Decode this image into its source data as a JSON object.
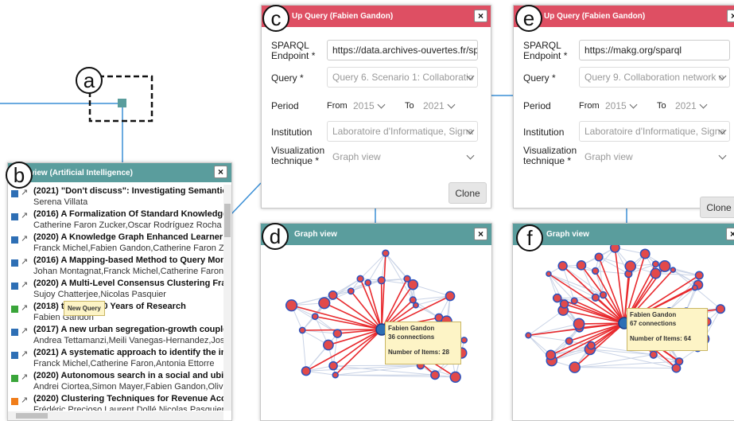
{
  "badges": {
    "a": "a",
    "b": "b",
    "c": "c",
    "d": "d",
    "e": "e",
    "f": "f"
  },
  "colors": {
    "teal": "#5a9d9d",
    "red_header": "#de4f63",
    "edge": "#e8292d",
    "node_fill": "#e24a4a",
    "node_stroke": "#2a52be",
    "blue": "#2e6fb5",
    "green": "#3aa53a",
    "orange": "#f07d1a",
    "link_line": "#3a8fd6"
  },
  "list_panel": {
    "title": "view (Artificial Intelligence)",
    "close": "×",
    "tooltip": "New Query",
    "items": [
      {
        "title": "(2021) \"Don't discuss\": Investigating Semantic and",
        "authors": "Serena Villata",
        "color": "blue"
      },
      {
        "title": "(2016) A Formalization Of Standard Knowledge Ar",
        "authors": "Catherine Faron Zucker,Oscar Rodríguez Rocha",
        "color": "blue"
      },
      {
        "title": "(2020) A Knowledge Graph Enhanced Learner Mo",
        "authors": "Franck Michel,Fabien Gandon,Catherine Faron Zucke",
        "color": "blue"
      },
      {
        "title": "(2016) A Mapping-based Method to Query Mongo",
        "authors": "Johan Montagnat,Franck Michel,Catherine Faron Zu",
        "color": "blue"
      },
      {
        "title": "(2020) A Multi-Level Consensus Clustering Frame",
        "authors": "Sujoy Chatterjee,Nicolas Pasquier",
        "color": "blue"
      },
      {
        "title": "(2018)          the First 20 Years of Research",
        "authors": "Fabien Gandon",
        "color": "green"
      },
      {
        "title": "(2017) A new urban segregation-growth coupled",
        "authors": "Andrea Tettamanzi,Meili Vanegas-Hernandez,José T",
        "color": "blue"
      },
      {
        "title": "(2021) A systematic approach to identify the inforn",
        "authors": "Franck Michel,Catherine Faron,Antonia Ettorre",
        "color": "blue"
      },
      {
        "title": "(2020) Autonomous search in a social and ubiqui",
        "authors": "Andrei Ciortea,Simon Mayer,Fabien Gandon,Olivier",
        "color": "green"
      },
      {
        "title": "(2020) Clustering Techniques for Revenue Accou",
        "authors": "Frédéric Precioso,Laurent Dollé,Nicolas Pasquier,Tia",
        "color": "orange"
      }
    ]
  },
  "query_c": {
    "title": "Up Query (Fabien Gandon)",
    "close": "×",
    "endpoint_label": "SPARQL Endpoint *",
    "endpoint_value": "https://data.archives-ouvertes.fr/sp",
    "query_label": "Query *",
    "query_value": "Query 6. Scenario 1: Collaboratio",
    "period_label": "Period",
    "from_label": "From",
    "from_value": "2015",
    "to_label": "To",
    "to_value": "2021",
    "institution_label": "Institution",
    "institution_value": "Laboratoire d'Informatique, Signa",
    "viz_label": "Visualization technique *",
    "viz_value": "Graph view",
    "clone_label": "Clone"
  },
  "query_e": {
    "title": "Up Query (Fabien Gandon)",
    "close": "×",
    "endpoint_label": "SPARQL Endpoint *",
    "endpoint_value": "https://makg.org/sparql",
    "query_label": "Query *",
    "query_value": "Query 9. Collaboration network o",
    "period_label": "Period",
    "from_label": "From",
    "from_value": "2015",
    "to_label": "To",
    "to_value": "2021",
    "institution_label": "Institution",
    "institution_value": "Laboratoire d'Informatique, Signa",
    "viz_label": "Visualization technique *",
    "viz_value": "Graph view",
    "clone_label": "Clone"
  },
  "graph_d": {
    "title": "Graph view",
    "close": "×",
    "center_name": "Fabien Gandon",
    "connections": "36 connections",
    "items_text": "Number of Items: 28",
    "center_node": "Fabien Gandon",
    "connection_count": 36,
    "item_count": 28
  },
  "graph_f": {
    "title": "Graph view",
    "close": "×",
    "center_name": "Fabien Gandon",
    "connections": "67 connections",
    "items_text": "Number of Items: 64",
    "center_node": "Fabien Gandon",
    "connection_count": 67,
    "item_count": 64
  }
}
